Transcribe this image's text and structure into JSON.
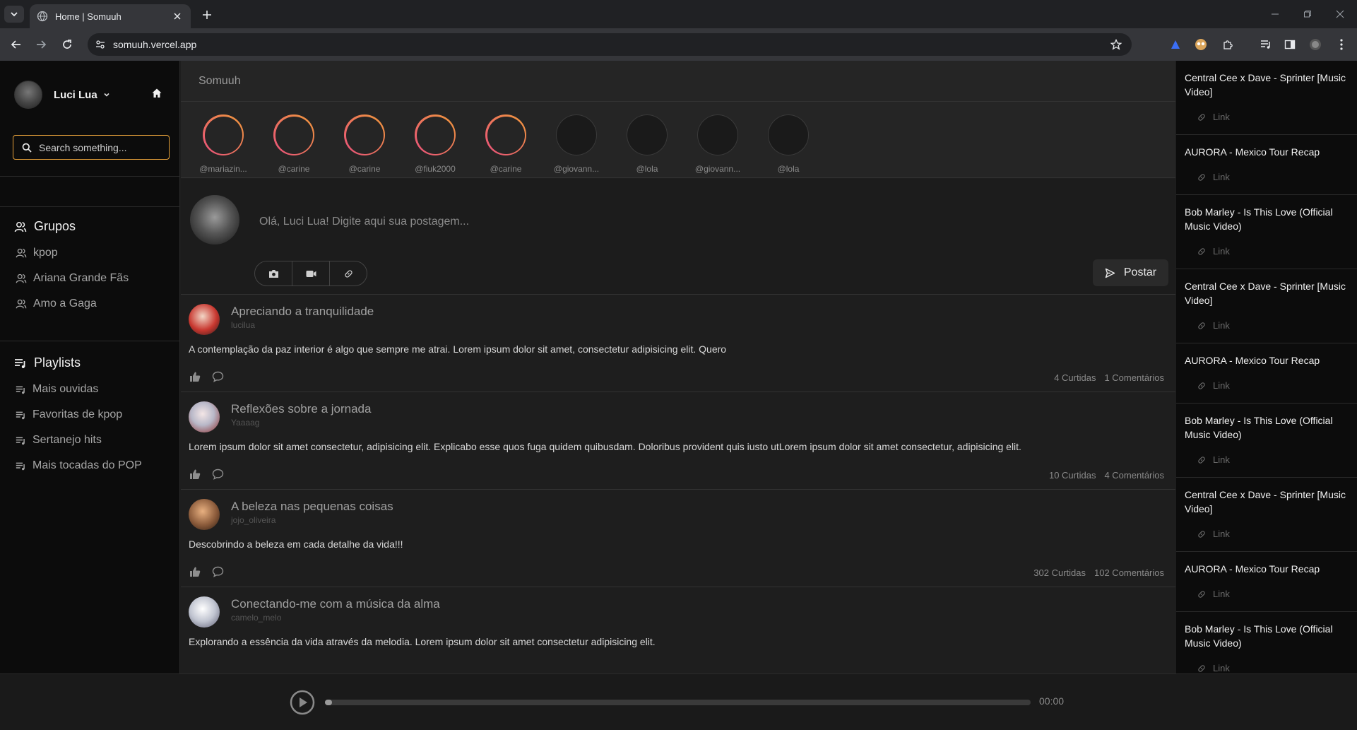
{
  "browser": {
    "tab_title": "Home | Somuuh",
    "url": "somuuh.vercel.app"
  },
  "sidebar": {
    "user_name": "Luci Lua",
    "search_placeholder": "Search something...",
    "groups_title": "Grupos",
    "groups": [
      {
        "label": "kpop"
      },
      {
        "label": "Ariana Grande Fãs"
      },
      {
        "label": "Amo a Gaga"
      }
    ],
    "playlists_title": "Playlists",
    "playlists": [
      {
        "label": "Mais ouvidas"
      },
      {
        "label": "Favoritas de kpop"
      },
      {
        "label": "Sertanejo hits"
      },
      {
        "label": "Mais tocadas do POP"
      }
    ]
  },
  "main": {
    "brand": "Somuuh",
    "stories": [
      {
        "user": "@mariazin...",
        "seen": false
      },
      {
        "user": "@carine",
        "seen": false
      },
      {
        "user": "@carine",
        "seen": false
      },
      {
        "user": "@fiuk2000",
        "seen": false
      },
      {
        "user": "@carine",
        "seen": false
      },
      {
        "user": "@giovann...",
        "seen": true
      },
      {
        "user": "@lola",
        "seen": true
      },
      {
        "user": "@giovann...",
        "seen": true
      },
      {
        "user": "@lola",
        "seen": true
      }
    ],
    "composer": {
      "placeholder": "Olá, Luci Lua! Digite aqui sua postagem...",
      "post_label": "Postar"
    },
    "posts": [
      {
        "title": "Apreciando a tranquilidade",
        "user": "lucilua",
        "text": "A contemplação da paz interior é algo que sempre me atrai. Lorem ipsum dolor sit amet, consectetur adipisicing elit. Quero",
        "likes": "4 Curtidas",
        "comments": "1 Comentários",
        "avatar_color": "#c8372f"
      },
      {
        "title": "Reflexões sobre a jornada",
        "user": "Yaaaag",
        "text": "Lorem ipsum dolor sit amet consectetur, adipisicing elit. Explicabo esse quos fuga quidem quibusdam. Doloribus provident quis iusto utLorem ipsum dolor sit amet consectetur, adipisicing elit.",
        "likes": "10 Curtidas",
        "comments": "4 Comentários",
        "avatar_color": "#b8b8c8"
      },
      {
        "title": "A beleza nas pequenas coisas",
        "user": "jojo_oliveira",
        "text": "Descobrindo a beleza em cada detalhe da vida!!!",
        "likes": "302 Curtidas",
        "comments": "102 Comentários",
        "avatar_color": "#8a5a3a"
      },
      {
        "title": "Conectando-me com a música da alma",
        "user": "camelo_melo",
        "text": "Explorando a essência da vida através da melodia. Lorem ipsum dolor sit amet consectetur adipisicing elit.",
        "likes": "",
        "comments": "",
        "avatar_color": "#c0c4d0"
      }
    ]
  },
  "videos": [
    {
      "title": "Central Cee x Dave - Sprinter [Music Video]",
      "link": "Link"
    },
    {
      "title": "AURORA - Mexico Tour Recap",
      "link": "Link"
    },
    {
      "title": "Bob Marley - Is This Love (Official Music Video)",
      "link": "Link"
    },
    {
      "title": "Central Cee x Dave - Sprinter [Music Video]",
      "link": "Link"
    },
    {
      "title": "AURORA - Mexico Tour Recap",
      "link": "Link"
    },
    {
      "title": "Bob Marley - Is This Love (Official Music Video)",
      "link": "Link"
    },
    {
      "title": "Central Cee x Dave - Sprinter [Music Video]",
      "link": "Link"
    },
    {
      "title": "AURORA - Mexico Tour Recap",
      "link": "Link"
    },
    {
      "title": "Bob Marley - Is This Love (Official Music Video)",
      "link": "Link"
    }
  ],
  "player": {
    "time": "00:00",
    "progress": 0
  },
  "colors": {
    "story_ring_start": "#e84f7c",
    "story_ring_end": "#f09a3a",
    "search_border": "#e8a23a"
  }
}
